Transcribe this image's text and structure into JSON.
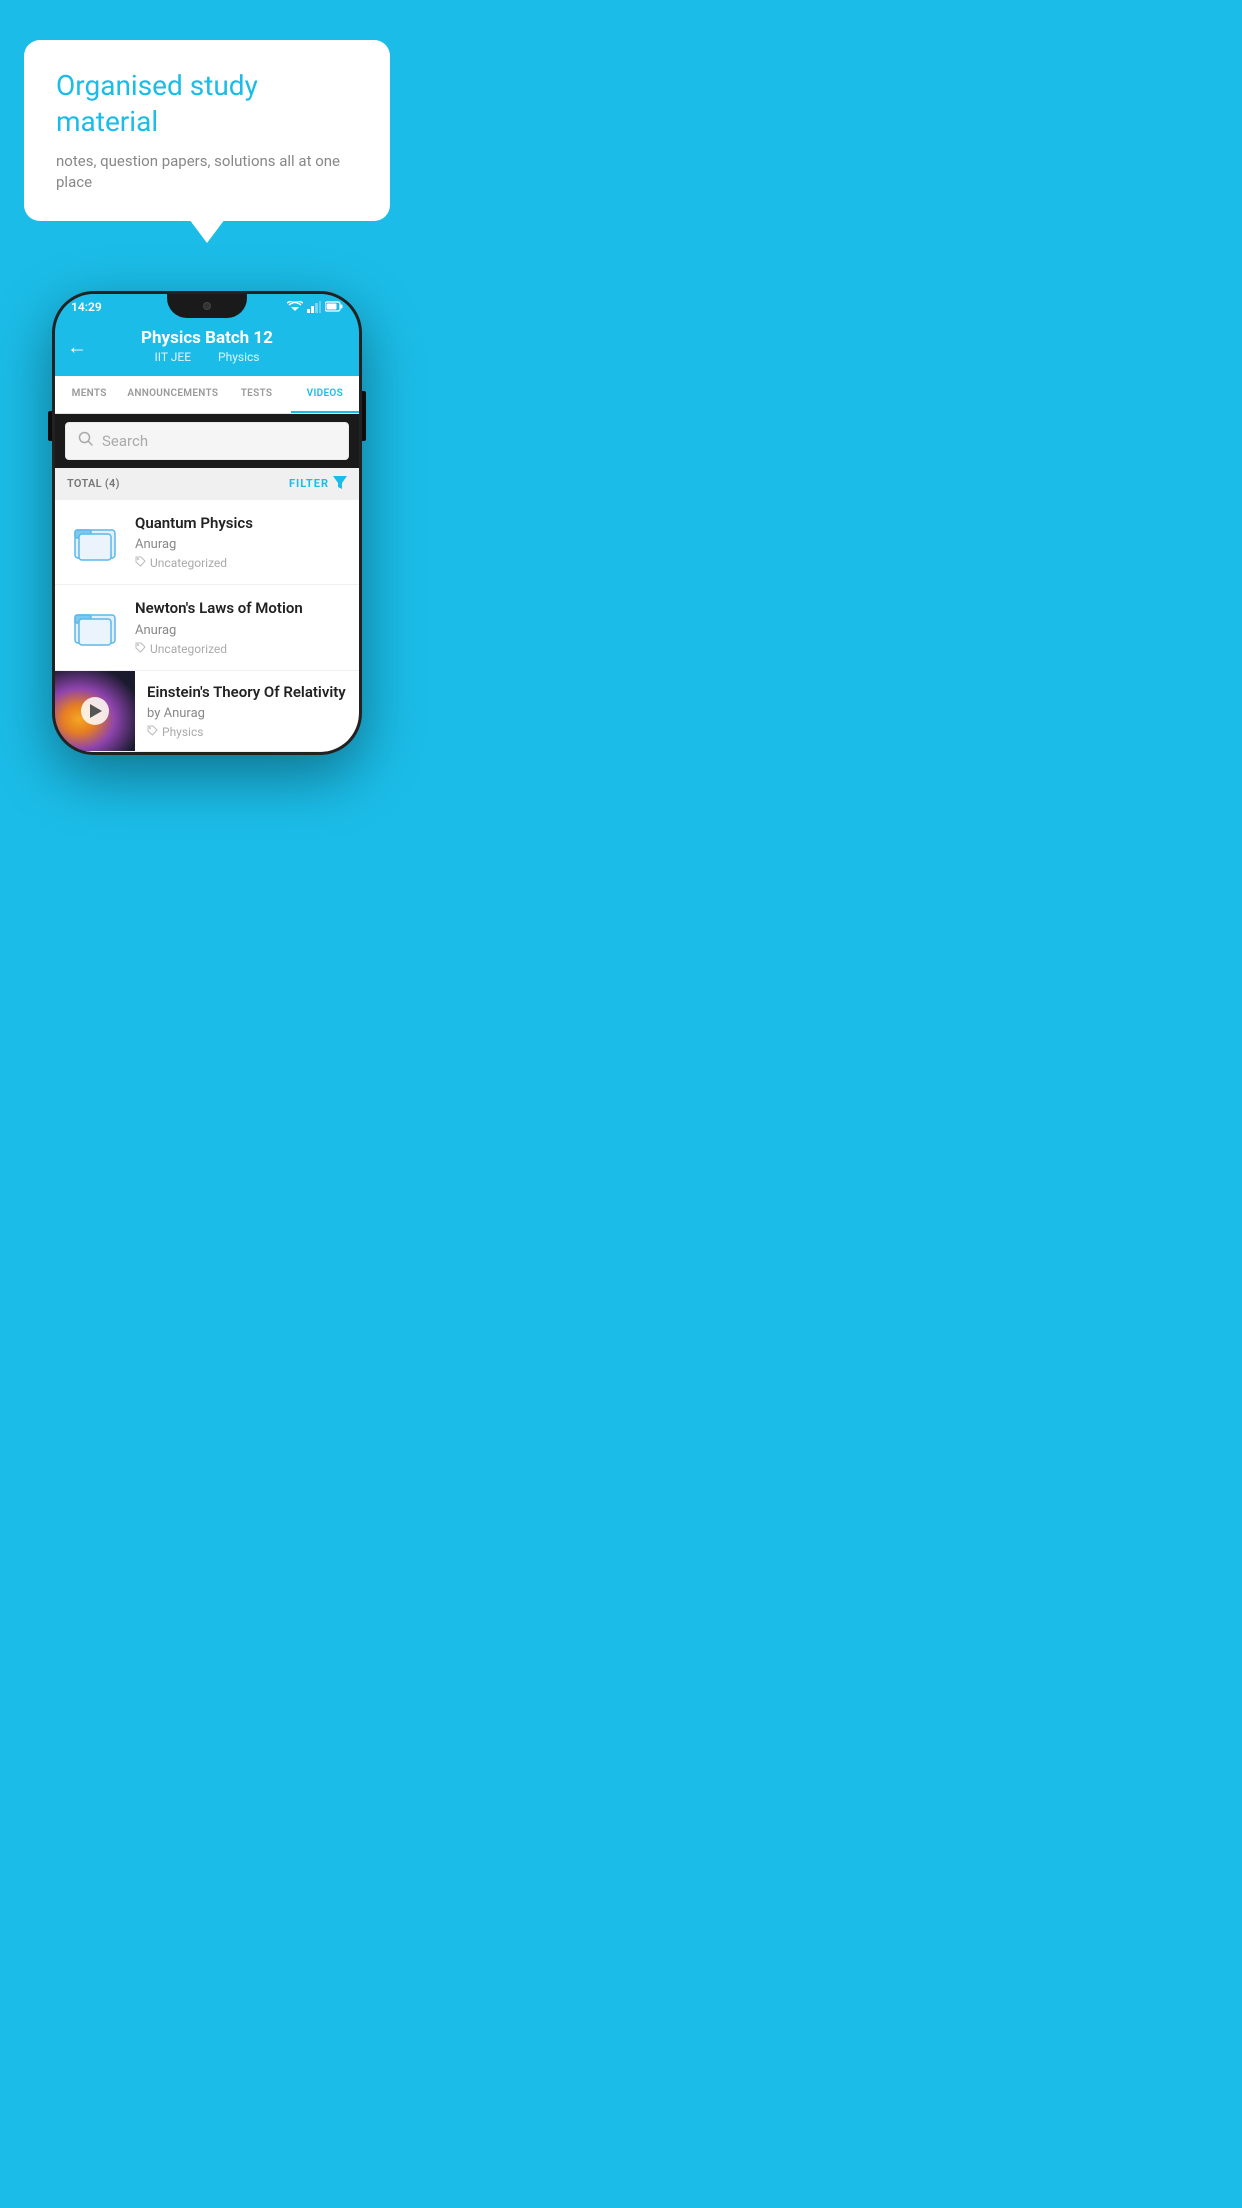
{
  "promo": {
    "title": "Organised study material",
    "subtitle": "notes, question papers, solutions all at one place"
  },
  "phone": {
    "statusBar": {
      "time": "14:29"
    },
    "header": {
      "title": "Physics Batch 12",
      "subtitle1": "IIT JEE",
      "subtitle2": "Physics",
      "backLabel": "←"
    },
    "tabs": [
      {
        "label": "MENTS",
        "active": false
      },
      {
        "label": "ANNOUNCEMENTS",
        "active": false
      },
      {
        "label": "TESTS",
        "active": false
      },
      {
        "label": "VIDEOS",
        "active": true
      }
    ],
    "search": {
      "placeholder": "Search"
    },
    "filterBar": {
      "total": "TOTAL (4)",
      "filterLabel": "FILTER"
    },
    "videos": [
      {
        "id": "quantum",
        "title": "Quantum Physics",
        "author": "Anurag",
        "tag": "Uncategorized",
        "type": "folder"
      },
      {
        "id": "newton",
        "title": "Newton's Laws of Motion",
        "author": "Anurag",
        "tag": "Uncategorized",
        "type": "folder"
      },
      {
        "id": "einstein",
        "title": "Einstein's Theory Of Relativity",
        "author": "by Anurag",
        "tag": "Physics",
        "type": "video"
      }
    ]
  }
}
